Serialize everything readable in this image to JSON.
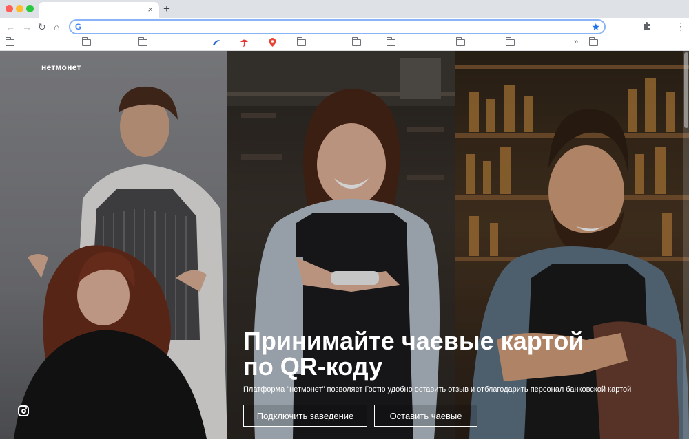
{
  "browser": {
    "tab_close": "×",
    "new_tab": "+",
    "nav": {
      "back": "←",
      "forward": "→",
      "reload": "↻",
      "home": "⌂"
    },
    "address_bar": {
      "value": "",
      "placeholder": "",
      "engine_icon": "google-g-icon"
    },
    "bookmark_star": "★",
    "menu": "⋮",
    "overflow": "»"
  },
  "hero": {
    "logo": "нетмонет",
    "headline_line1": "Принимайте чаевые картой",
    "headline_line2": "по QR-коду",
    "subtext": "Платформа \"нетмонет\" позволяет Гостю удобно оставить отзыв и отблагодарить персонал банковской картой",
    "button_connect": "Подключить заведение",
    "button_tip": "Оставить чаевые"
  },
  "colors": {
    "accent": "#1a73e8",
    "text_on_image": "#ffffff"
  }
}
